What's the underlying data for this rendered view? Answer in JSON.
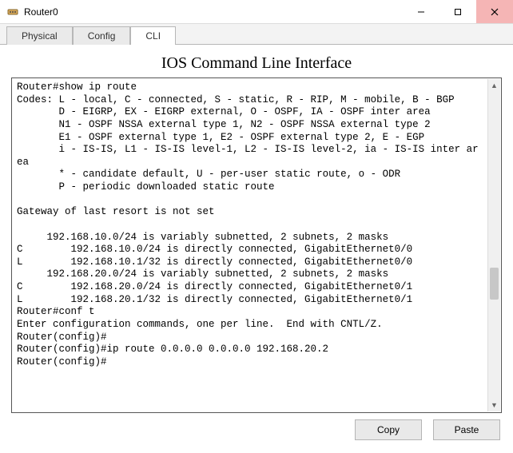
{
  "window": {
    "title": "Router0"
  },
  "tabs": {
    "physical": "Physical",
    "config": "Config",
    "cli": "CLI"
  },
  "content": {
    "heading": "IOS Command Line Interface"
  },
  "terminal_lines": [
    "Router#show ip route",
    "Codes: L - local, C - connected, S - static, R - RIP, M - mobile, B - BGP",
    "       D - EIGRP, EX - EIGRP external, O - OSPF, IA - OSPF inter area",
    "       N1 - OSPF NSSA external type 1, N2 - OSPF NSSA external type 2",
    "       E1 - OSPF external type 1, E2 - OSPF external type 2, E - EGP",
    "       i - IS-IS, L1 - IS-IS level-1, L2 - IS-IS level-2, ia - IS-IS inter area",
    "       * - candidate default, U - per-user static route, o - ODR",
    "       P - periodic downloaded static route",
    "",
    "Gateway of last resort is not set",
    "",
    "     192.168.10.0/24 is variably subnetted, 2 subnets, 2 masks",
    "C        192.168.10.0/24 is directly connected, GigabitEthernet0/0",
    "L        192.168.10.1/32 is directly connected, GigabitEthernet0/0",
    "     192.168.20.0/24 is variably subnetted, 2 subnets, 2 masks",
    "C        192.168.20.0/24 is directly connected, GigabitEthernet0/1",
    "L        192.168.20.1/32 is directly connected, GigabitEthernet0/1",
    "Router#conf t",
    "Enter configuration commands, one per line.  End with CNTL/Z.",
    "Router(config)#",
    "Router(config)#ip route 0.0.0.0 0.0.0.0 192.168.20.2",
    "Router(config)#"
  ],
  "buttons": {
    "copy": "Copy",
    "paste": "Paste"
  }
}
